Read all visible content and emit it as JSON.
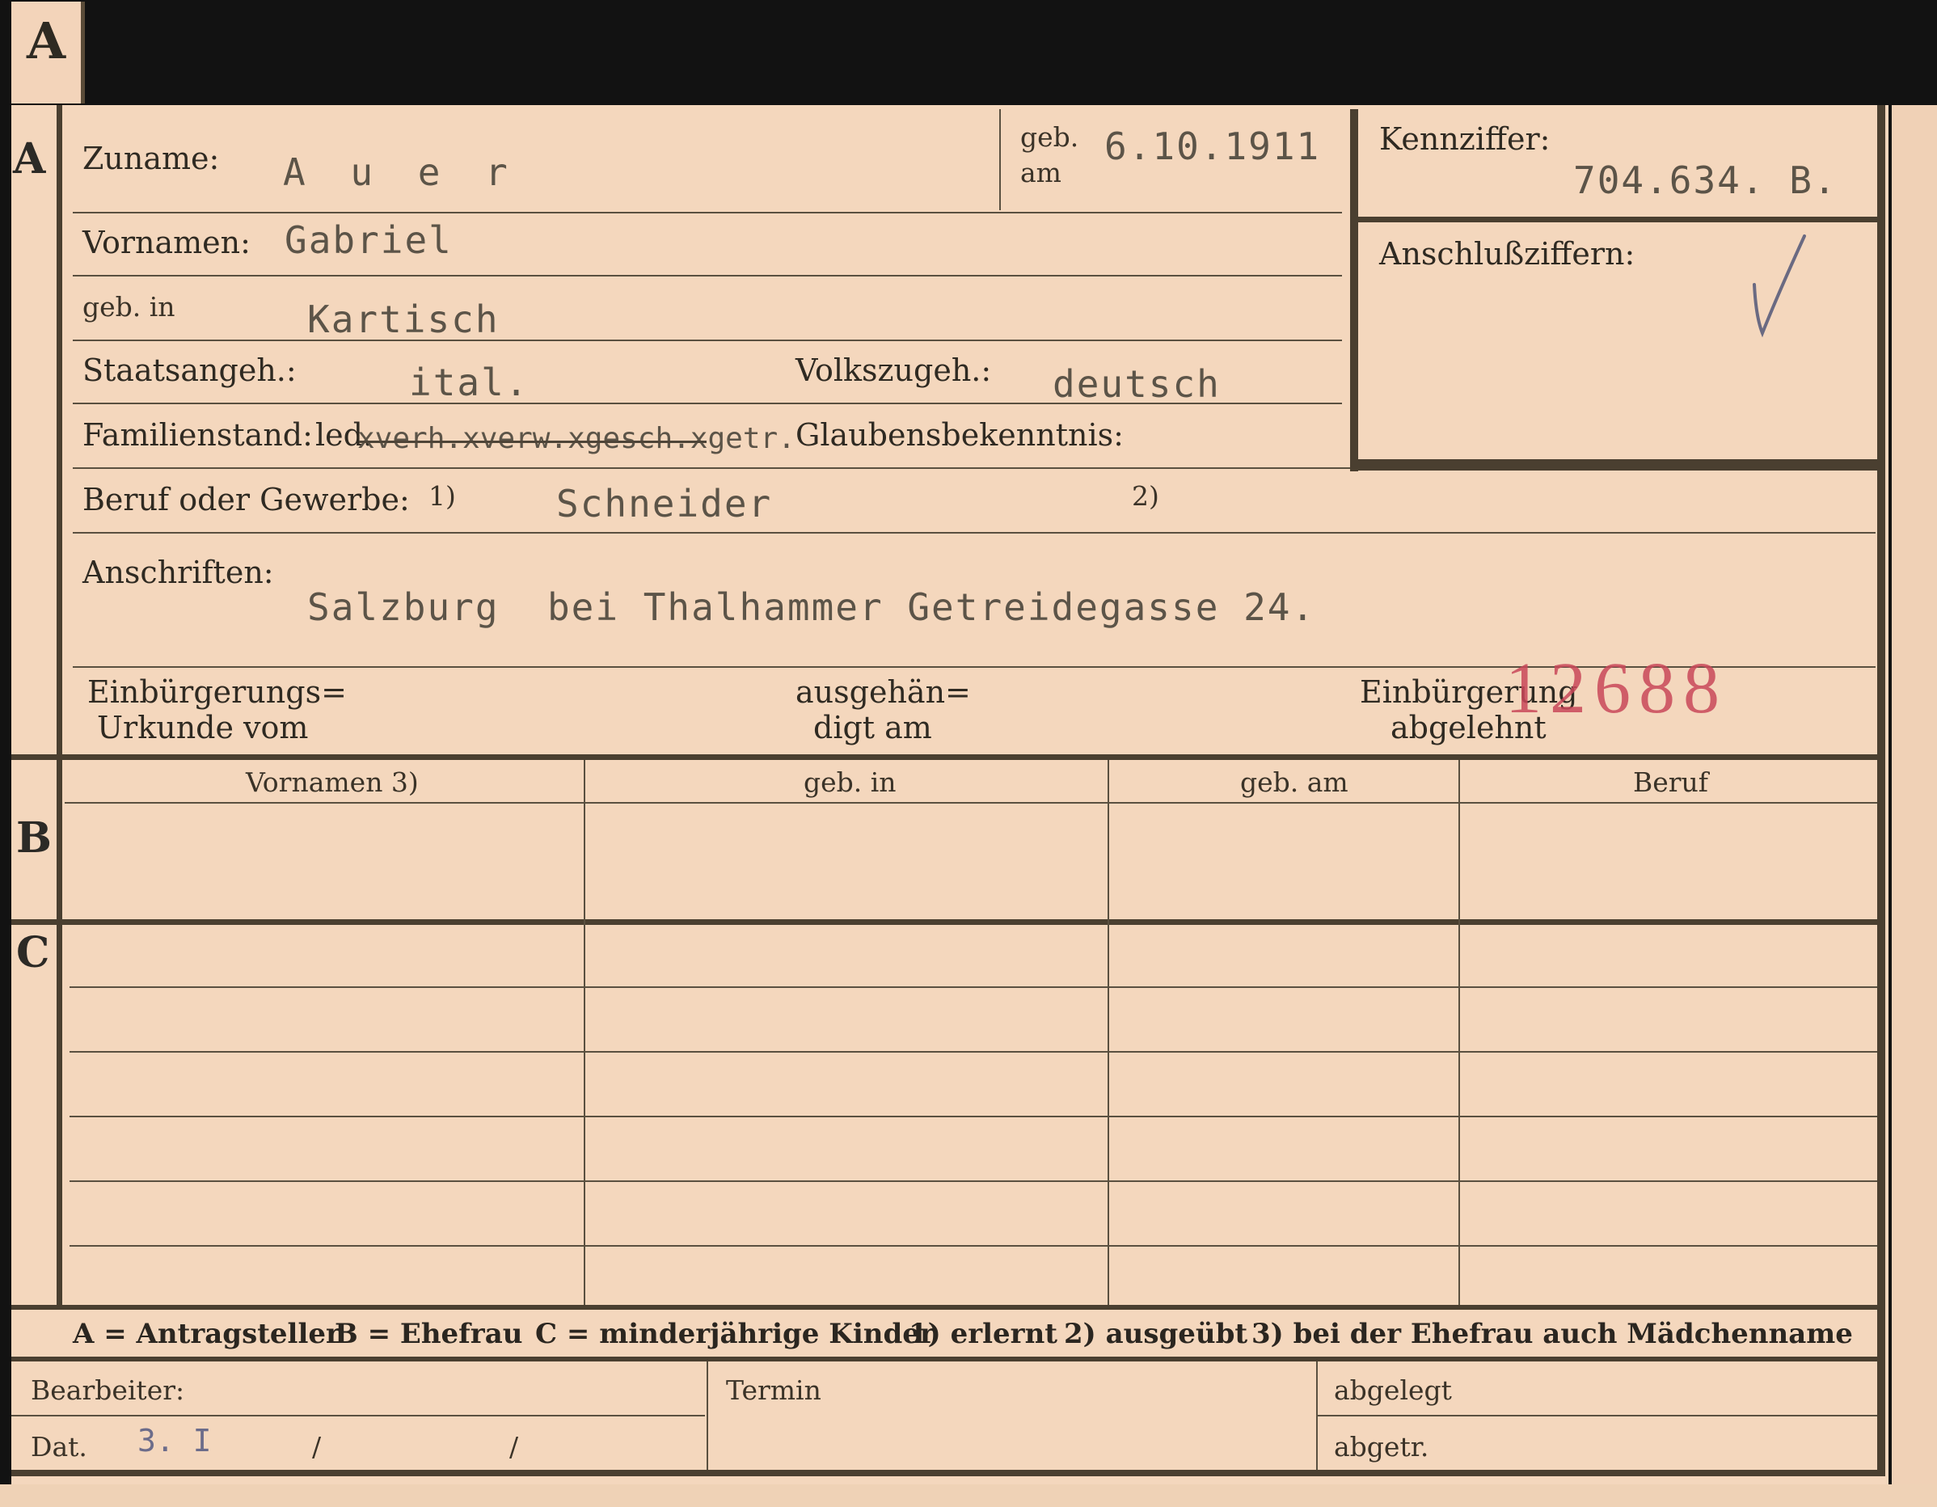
{
  "tab_letter": "A",
  "sections": {
    "a": "A",
    "b": "B",
    "c": "C"
  },
  "person": {
    "zuname_label": "Zuname:",
    "zuname_value": "A u e r",
    "geb_am_label_1": "geb.",
    "geb_am_label_2": "am",
    "geb_am_value": "6.10.1911",
    "vornamen_label": "Vornamen:",
    "vornamen_value": "Gabriel",
    "geb_in_label": "geb. in",
    "geb_in_value": "Kartisch",
    "staatsangeh_label": "Staatsangeh.:",
    "staatsangeh_value": "ital.",
    "volkszugeh_label": "Volkszugeh.:",
    "volkszugeh_value": "deutsch",
    "familienstand_label": "Familienstand:",
    "familienstand_value": "led.",
    "familienstand_struck": "xverh.xverw.xgesch.xgetr.",
    "glaubens_label": "Glaubensbekenntnis:",
    "beruf_label": "Beruf oder Gewerbe:",
    "beruf_note1": "1)",
    "beruf_value": "Schneider",
    "beruf_note2": "2)",
    "anschriften_label": "Anschriften:",
    "anschriften_value": "Salzburg  bei Thalhammer Getreidegasse 24."
  },
  "kennziffer": {
    "label": "Kennziffer:",
    "value": "704.634. B.",
    "anschluss_label": "Anschlußziffern:"
  },
  "einbuergerung": {
    "urkunde_1": "Einbürgerungs=",
    "urkunde_2": "Urkunde vom",
    "ausgehaendigt_1": "ausgehän=",
    "ausgehaendigt_2": "digt am",
    "abgelehnt_1": "Einbürgerung",
    "abgelehnt_2": "abgelehnt",
    "stamp_number": "12688"
  },
  "table_headers": [
    "Vornamen 3)",
    "geb. in",
    "geb. am",
    "Beruf"
  ],
  "legend": {
    "a": "A = Antragsteller",
    "b": "B = Ehefrau",
    "c": "C = minderjährige Kinder",
    "n1": "1) erlernt",
    "n2": "2) ausgeübt",
    "n3": "3) bei der Ehefrau auch Mädchenname"
  },
  "footer": {
    "bearbeiter_label": "Bearbeiter:",
    "dat_label": "Dat.",
    "dat_value": "3. I",
    "slash1": "/",
    "slash2": "/",
    "termin_label": "Termin",
    "abgelegt_label": "abgelegt",
    "abgetr_label": "abgetr."
  },
  "colors": {
    "paper": "#f4d7bd",
    "ink": "#2f2a22",
    "stamp": "#c9485a",
    "typewriter": "#5c5448"
  }
}
